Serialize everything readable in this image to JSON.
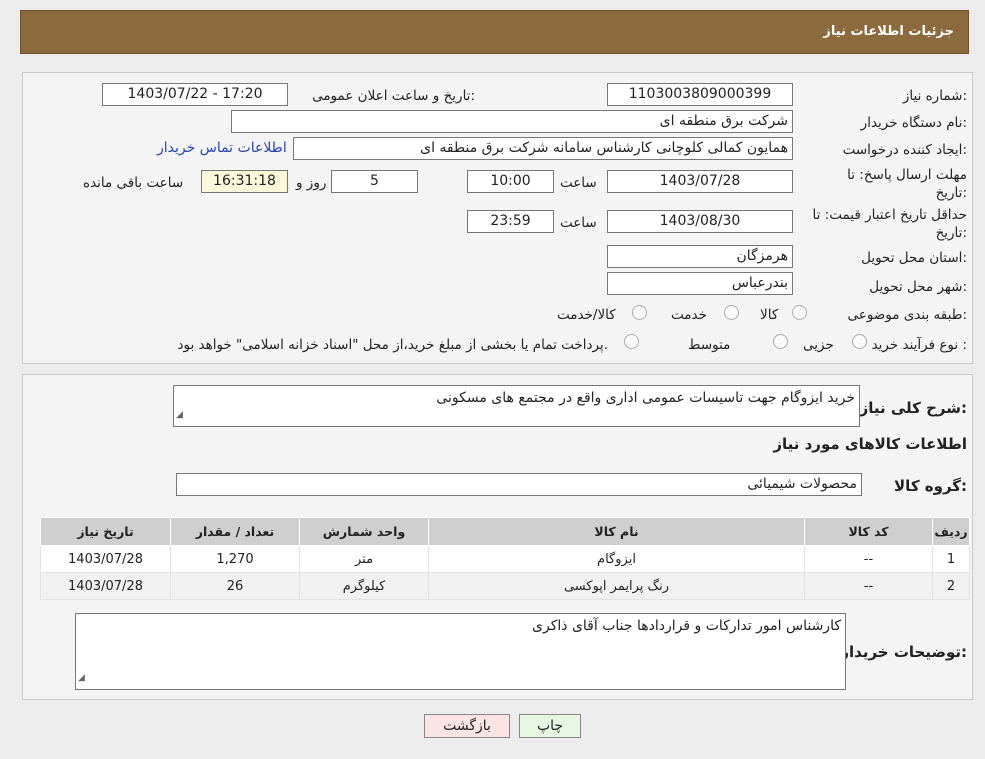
{
  "header": {
    "title": "جزئیات اطلاعات نیاز"
  },
  "form": {
    "need_number_label": "شماره نیاز:",
    "need_number": "1103003809000399",
    "announce_label": "تاریخ و ساعت اعلان عمومی:",
    "announce_value": "1403/07/22 - 17:20",
    "buyer_org_label": "نام دستگاه خریدار:",
    "buyer_org": "شرکت برق منطقه ای",
    "requester_label": "ایجاد کننده درخواست:",
    "requester": "همایون کمالی کلوچانی کارشناس سامانه شرکت برق منطقه ای",
    "contact_link": "اطلاعات تماس خریدار",
    "deadline_label": "مهلت ارسال پاسخ: تا تاریخ:",
    "deadline_date": "1403/07/28",
    "time_word": "ساعت",
    "deadline_time": "10:00",
    "days_remaining": "5",
    "days_and_word": "روز و",
    "remaining_time": "16:31:18",
    "remaining_suffix": "ساعت باقی مانده",
    "validity_label": "حداقل تاریخ اعتبار قیمت: تا تاریخ:",
    "validity_date": "1403/08/30",
    "validity_time": "23:59",
    "province_label": "استان محل تحویل:",
    "province": "هرمزگان",
    "city_label": "شهر محل تحویل:",
    "city": "بندرعباس",
    "category_label": "طبقه بندی موضوعی:",
    "category_options": [
      "کالا",
      "خدمت",
      "کالا/خدمت"
    ],
    "process_label": "نوع فرآیند خرید :",
    "process_options": [
      "جزیی",
      "متوسط"
    ],
    "payment_note": "پرداخت تمام یا بخشی از مبلغ خرید،از محل \"اسناد خزانه اسلامی\" خواهد بود."
  },
  "details": {
    "summary_label": "شرح کلی نیاز:",
    "summary": "خرید ایزوگام جهت تاسیسات عمومی اداری واقع در مجتمع های مسکونی",
    "goods_info_title": "اطلاعات کالاهای مورد نیاز",
    "goods_group_label": "گروه کالا:",
    "goods_group": "محصولات شیمیائی",
    "table": {
      "headers": [
        "ردیف",
        "کد کالا",
        "نام کالا",
        "واحد شمارش",
        "تعداد / مقدار",
        "تاریخ نیاز"
      ],
      "rows": [
        [
          "1",
          "--",
          "ایزوگام",
          "متر",
          "1,270",
          "1403/07/28"
        ],
        [
          "2",
          "--",
          "رنگ پرایمر اپوکسی",
          "کیلوگرم",
          "26",
          "1403/07/28"
        ]
      ]
    },
    "buyer_notes_label": "توضیحات خریدار:",
    "buyer_notes": "کارشناس امور تدارکات و قراردادها جناب آقای ذاکری"
  },
  "actions": {
    "print_label": "چاپ",
    "back_label": "بازگشت"
  },
  "colors": {
    "header_bg": "#8b6a3e",
    "print_btn": "#e6f7e1",
    "back_btn": "#fde4e4"
  }
}
